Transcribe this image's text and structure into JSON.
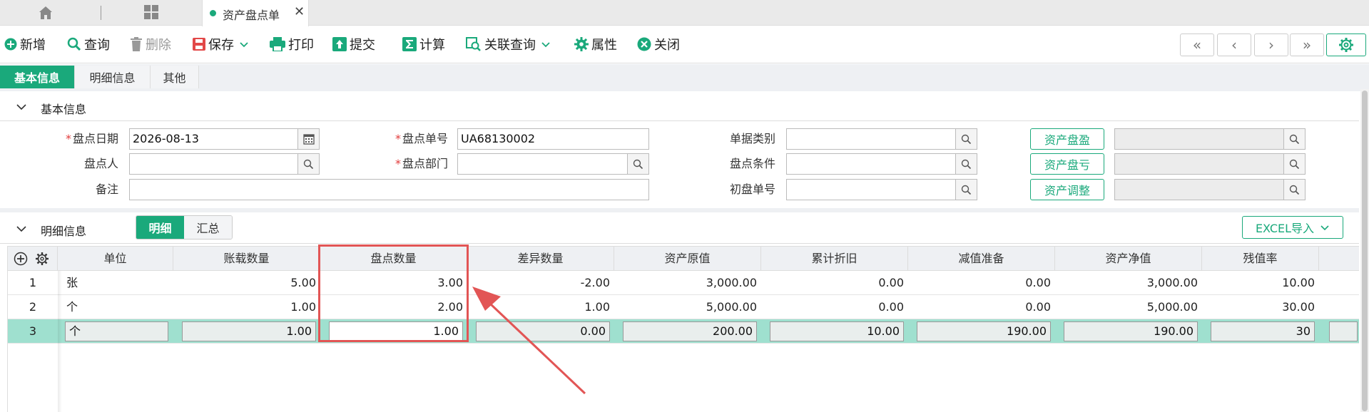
{
  "tabbar": {
    "doc_tab_label": "资产盘点单",
    "close_glyph": "✕"
  },
  "toolbar": {
    "add": "新增",
    "query": "查询",
    "delete": "删除",
    "save": "保存",
    "print": "打印",
    "submit": "提交",
    "calc": "计算",
    "related_query": "关联查询",
    "props": "属性",
    "close": "关闭",
    "nav_first": "«",
    "nav_prev": "‹",
    "nav_next": "›",
    "nav_last": "»"
  },
  "section_tabs": [
    "基本信息",
    "明细信息",
    "其他"
  ],
  "basic": {
    "title": "基本信息",
    "date_label": "盘点日期",
    "date_value": "2026-08-13",
    "no_label": "盘点单号",
    "no_value": "UA68130002",
    "type_label": "单据类别",
    "type_value": "",
    "person_label": "盘点人",
    "person_value": "",
    "dept_label": "盘点部门",
    "dept_value": "",
    "cond_label": "盘点条件",
    "cond_value": "",
    "remark_label": "备注",
    "remark_value": "",
    "first_no_label": "初盘单号",
    "first_no_value": "",
    "btn_surplus": "资产盘盈",
    "btn_loss": "资产盘亏",
    "btn_adjust": "资产调整"
  },
  "detail": {
    "title": "明细信息",
    "subtabs": [
      "明细",
      "汇总"
    ],
    "excel_label": "EXCEL导入",
    "columns": [
      "单位",
      "账载数量",
      "盘点数量",
      "差异数量",
      "资产原值",
      "累计折旧",
      "减值准备",
      "资产净值",
      "残值率"
    ],
    "rows": [
      [
        "1",
        "张",
        "5.00",
        "3.00",
        "-2.00",
        "3,000.00",
        "0.00",
        "0.00",
        "3,000.00",
        "10.00"
      ],
      [
        "2",
        "个",
        "1.00",
        "2.00",
        "1.00",
        "5,000.00",
        "0.00",
        "0.00",
        "5,000.00",
        "30.00"
      ],
      [
        "3",
        "个",
        "1.00",
        "1.00",
        "0.00",
        "200.00",
        "10.00",
        "190.00",
        "190.00",
        "30"
      ]
    ]
  },
  "colors": {
    "accent": "#1aa97b",
    "highlight": "#e25555",
    "selected_row": "#9fe0cf"
  }
}
